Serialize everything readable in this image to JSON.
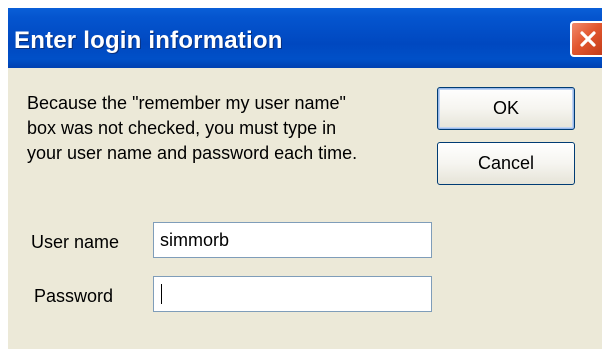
{
  "dialog": {
    "title": "Enter login information",
    "message": "Because the \"remember my user name\"\nbox was not checked, you must type in\nyour user name and password each time.",
    "close_icon": "close-icon",
    "colors": {
      "titlebar": "#0050c8",
      "close_button": "#e2572f",
      "background": "#ece9d8"
    }
  },
  "buttons": {
    "ok_label": "OK",
    "cancel_label": "Cancel"
  },
  "fields": {
    "username_label": "User name",
    "username_value": "simmorb",
    "password_label": "Password",
    "password_value": ""
  }
}
